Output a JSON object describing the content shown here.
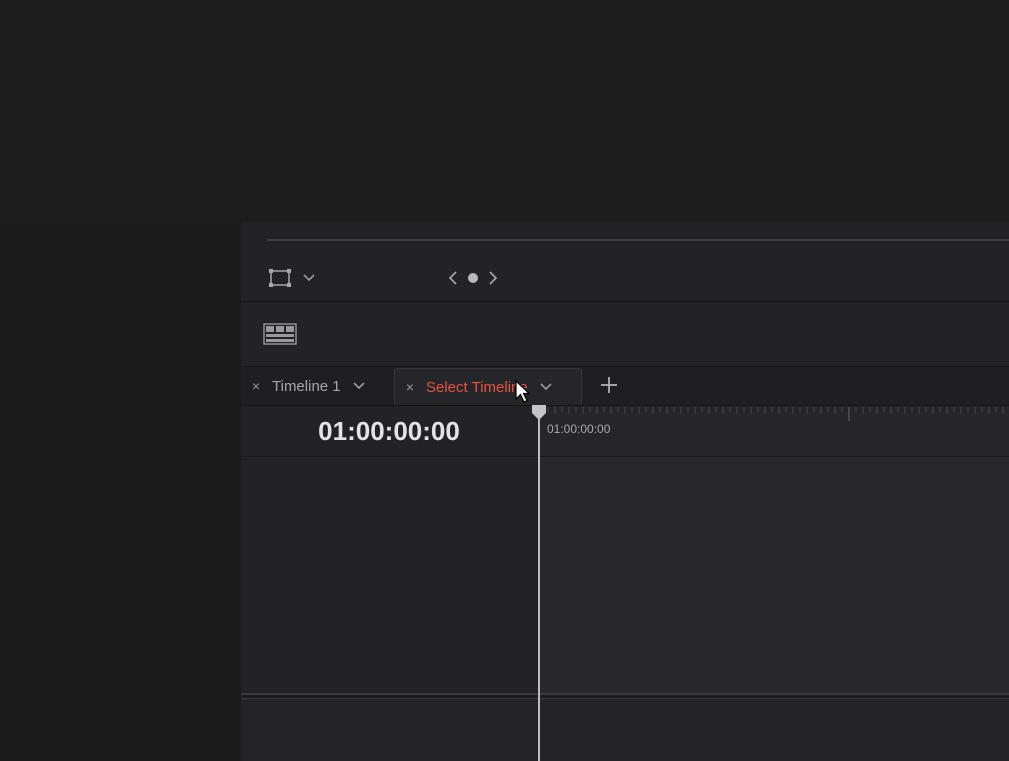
{
  "timeline": {
    "tabs": [
      {
        "label": "Timeline 1",
        "close_icon": "×"
      },
      {
        "label": "Select Timeline",
        "close_icon": "×"
      }
    ],
    "add_tab_icon": "plus-icon",
    "timecode": "01:00:00:00",
    "ruler_start": "01:00:00:00"
  },
  "viewer": {
    "transform_icon": "transform-box-icon",
    "nav_icons": [
      "chevron-left-icon",
      "dot-icon",
      "chevron-right-icon"
    ]
  },
  "colors": {
    "active_tab_text": "#e5533d",
    "background": "#1a1a1b",
    "panel": "#232325"
  }
}
